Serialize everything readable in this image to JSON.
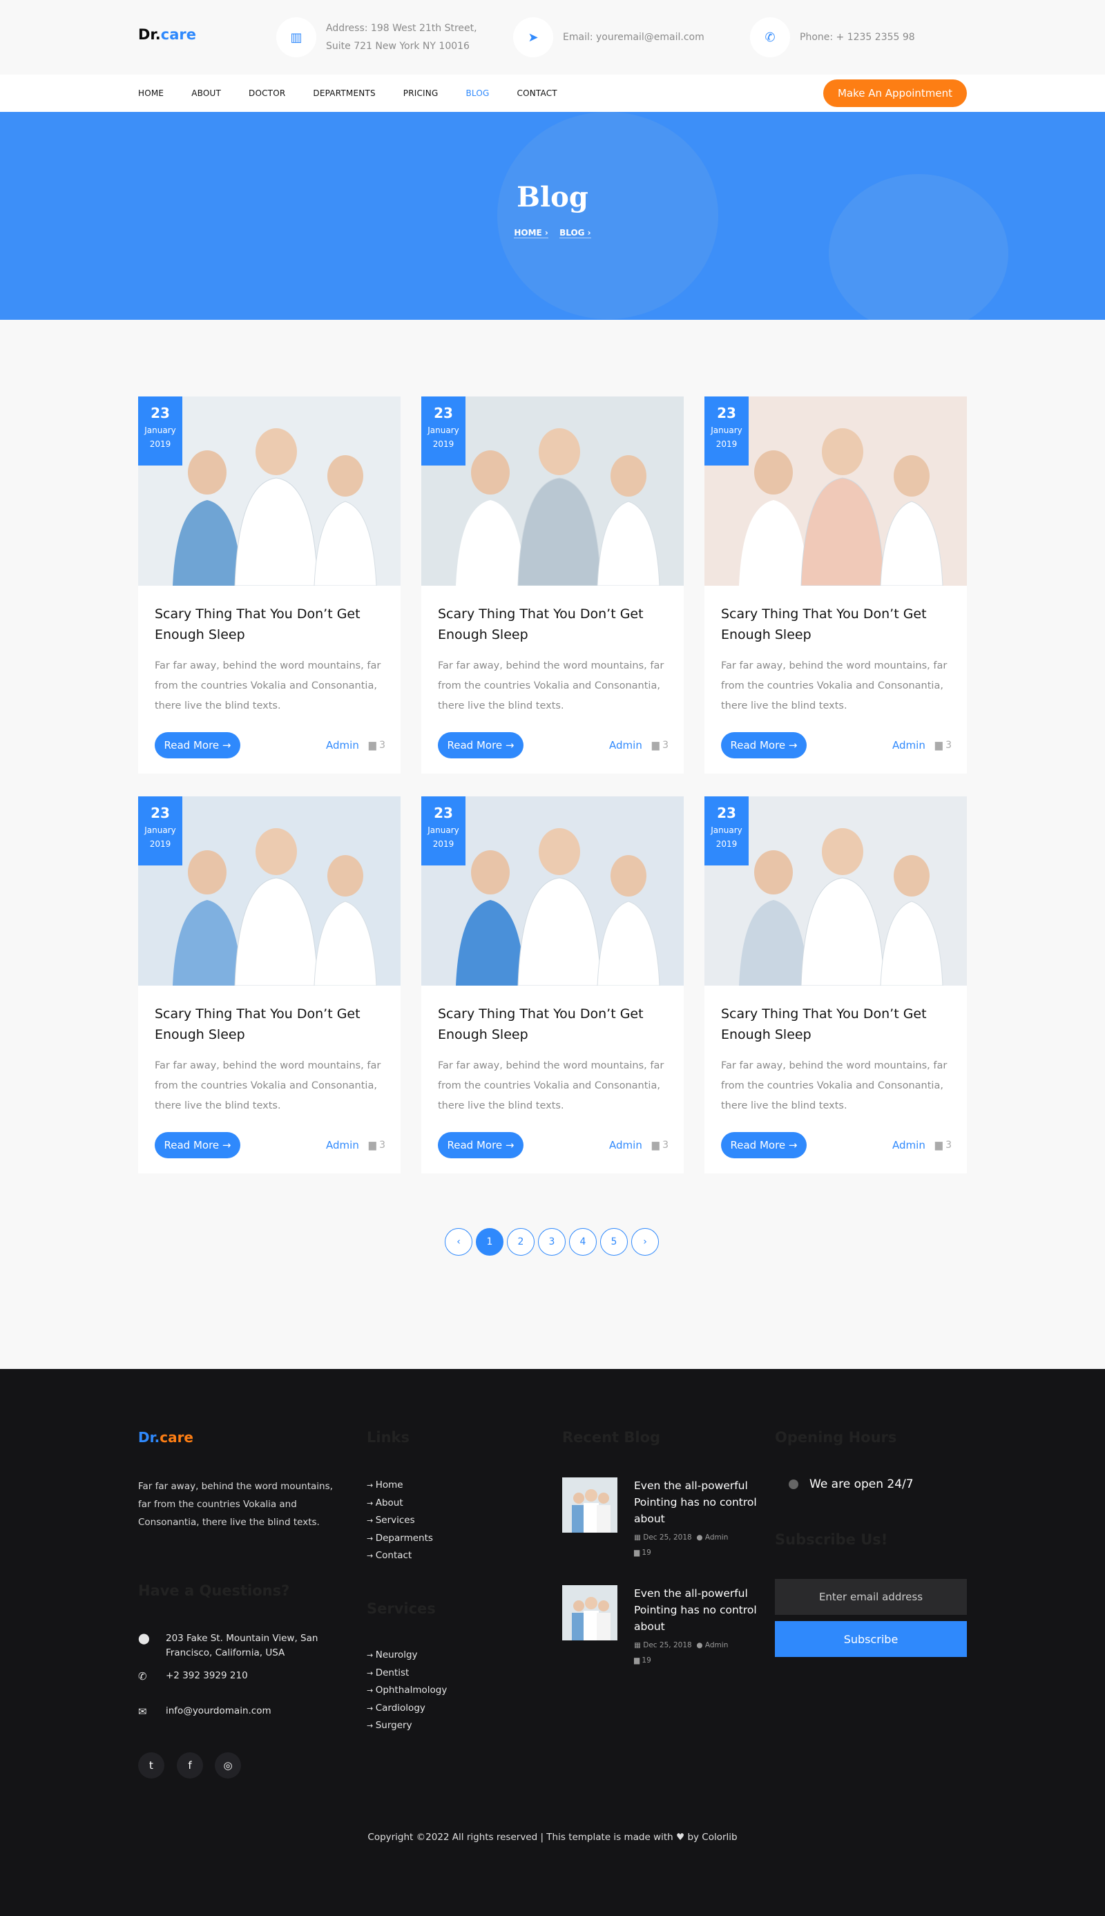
{
  "brand": {
    "name_a": "Dr.",
    "name_b": "care"
  },
  "contact": {
    "address": "Address: 198 West 21th Street, Suite 721 New York NY 10016",
    "email": "Email: youremail@email.com",
    "phone": "Phone: + 1235 2355 98"
  },
  "nav": {
    "items": [
      "HOME",
      "ABOUT",
      "DOCTOR",
      "DEPARTMENTS",
      "PRICING",
      "BLOG",
      "CONTACT"
    ],
    "active": "BLOG",
    "cta": "Make An Appointment"
  },
  "hero": {
    "title": "Blog",
    "crumbs": [
      "HOME ›",
      "BLOG ›"
    ]
  },
  "posts": [
    {
      "day": "23",
      "month": "January",
      "year": "2019",
      "title": "Scary Thing That You Don’t Get Enough Sleep",
      "excerpt": "Far far away, behind the word mountains, far from the countries Vokalia and Consonantia, there live the blind texts.",
      "cta": "Read More →",
      "author": "Admin",
      "comments": "3"
    },
    {
      "day": "23",
      "month": "January",
      "year": "2019",
      "title": "Scary Thing That You Don’t Get Enough Sleep",
      "excerpt": "Far far away, behind the word mountains, far from the countries Vokalia and Consonantia, there live the blind texts.",
      "cta": "Read More →",
      "author": "Admin",
      "comments": "3"
    },
    {
      "day": "23",
      "month": "January",
      "year": "2019",
      "title": "Scary Thing That You Don’t Get Enough Sleep",
      "excerpt": "Far far away, behind the word mountains, far from the countries Vokalia and Consonantia, there live the blind texts.",
      "cta": "Read More →",
      "author": "Admin",
      "comments": "3"
    },
    {
      "day": "23",
      "month": "January",
      "year": "2019",
      "title": "Scary Thing That You Don’t Get Enough Sleep",
      "excerpt": "Far far away, behind the word mountains, far from the countries Vokalia and Consonantia, there live the blind texts.",
      "cta": "Read More →",
      "author": "Admin",
      "comments": "3"
    },
    {
      "day": "23",
      "month": "January",
      "year": "2019",
      "title": "Scary Thing That You Don’t Get Enough Sleep",
      "excerpt": "Far far away, behind the word mountains, far from the countries Vokalia and Consonantia, there live the blind texts.",
      "cta": "Read More →",
      "author": "Admin",
      "comments": "3"
    },
    {
      "day": "23",
      "month": "January",
      "year": "2019",
      "title": "Scary Thing That You Don’t Get Enough Sleep",
      "excerpt": "Far far away, behind the word mountains, far from the countries Vokalia and Consonantia, there live the blind texts.",
      "cta": "Read More →",
      "author": "Admin",
      "comments": "3"
    }
  ],
  "pagination": {
    "prev": "‹",
    "pages": [
      "1",
      "2",
      "3",
      "4",
      "5"
    ],
    "current": "1",
    "next": "›"
  },
  "footer": {
    "about": "Far far away, behind the word mountains, far from the countries Vokalia and Consonantia, there live the blind texts.",
    "questions_title": "Have a Questions?",
    "address": "203 Fake St. Mountain View, San Francisco, California, USA",
    "phone": "+2 392 3929 210",
    "email": "info@yourdomain.com",
    "links_title": "Links",
    "links": [
      "Home",
      "About",
      "Services",
      "Deparments",
      "Contact"
    ],
    "services_title": "Services",
    "services": [
      "Neurolgy",
      "Dentist",
      "Ophthalmology",
      "Cardiology",
      "Surgery"
    ],
    "recent_title": "Recent Blog",
    "recent": [
      {
        "title": "Even the all-powerful Pointing has no control about",
        "date": "Dec 25, 2018",
        "author": "Admin",
        "comments": "19"
      },
      {
        "title": "Even the all-powerful Pointing has no control about",
        "date": "Dec 25, 2018",
        "author": "Admin",
        "comments": "19"
      }
    ],
    "hours_title": "Opening Hours",
    "hours": "We are open 24/7",
    "subscribe_title": "Subscribe Us!",
    "subscribe_placeholder": "Enter email address",
    "subscribe_btn": "Subscribe",
    "copyright_a": "Copyright ©2022 All rights reserved | This template is made with",
    "copyright_b": "by Colorlib"
  },
  "colors": {
    "accent": "#2f89fc",
    "orange": "#fd7e14",
    "footer_bg": "#141416"
  }
}
